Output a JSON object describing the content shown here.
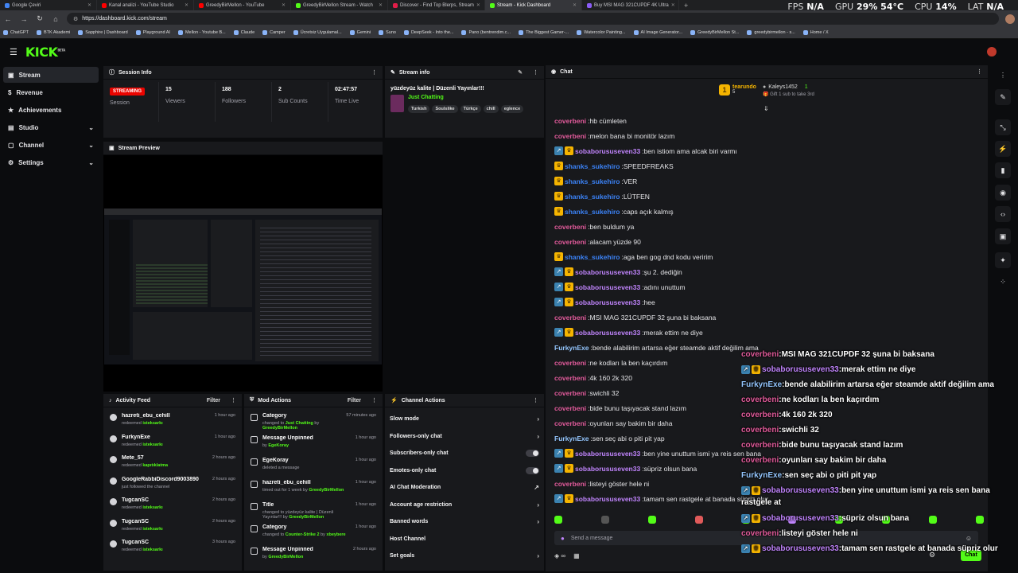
{
  "browser": {
    "tabs": [
      {
        "label": "Google Çeviri",
        "color": "#4285f4"
      },
      {
        "label": "Kanal analizi - YouTube Studio",
        "color": "#ff0000"
      },
      {
        "label": "GreedyBirMellon - YouTube",
        "color": "#ff0000"
      },
      {
        "label": "GreedyBirMellon Stream - Watch",
        "color": "#53fc18"
      },
      {
        "label": "Discover - Find Top Blerps, Stream",
        "color": "#e11d48"
      },
      {
        "label": "Stream - Kick Dashboard",
        "color": "#53fc18"
      },
      {
        "label": "Buy MSI MAG 321CUPDF 4K Ultra",
        "color": "#8b5cf6"
      }
    ],
    "new_tab": "+",
    "url": "https://dashboard.kick.com/stream",
    "bookmarks": [
      "ChatGPT",
      "BTK Akademi",
      "Sapphire | Dashboard",
      "Playground AI",
      "Mellon - Youtube B...",
      "Claude",
      "Camper",
      "Ücretsiz Uygulamal...",
      "Gemini",
      "Suno",
      "DeepSeek - Into the...",
      "Pano (bentrendim.c...",
      "The Biggest Gamer-...",
      "Watercolor Painting...",
      "AI Image Generator...",
      "GreedyBirMellon St...",
      "greedybirmellon - s...",
      "Home / X"
    ]
  },
  "perf": {
    "fps_label": "FPS",
    "fps": "N/A",
    "gpu_label": "GPU",
    "gpu": "29% 54°C",
    "cpu_label": "CPU",
    "cpu": "14%",
    "lat_label": "LAT",
    "lat": "N/A"
  },
  "app": {
    "logo": "KICK",
    "logo_sup": "BETA"
  },
  "sidebar": {
    "items": [
      {
        "label": "Stream"
      },
      {
        "label": "Revenue"
      },
      {
        "label": "Achievements"
      },
      {
        "label": "Studio"
      },
      {
        "label": "Channel"
      },
      {
        "label": "Settings"
      }
    ]
  },
  "session": {
    "title": "Session Info",
    "status": "STREAMING",
    "status_label": "Session",
    "viewers": "15",
    "viewers_label": "Viewers",
    "followers": "188",
    "followers_label": "Followers",
    "subs": "2",
    "subs_label": "Sub Counts",
    "time": "02:47:57",
    "time_label": "Time Live"
  },
  "stream_info": {
    "title": "Stream info",
    "stream_title": "yüzdeyüz kalite | Düzenli Yayınlar!!!",
    "category": "Just Chatting",
    "tags": [
      "Turkish",
      "Soulslike",
      "Türkçe",
      "chill",
      "eglence"
    ]
  },
  "preview": {
    "title": "Stream Preview"
  },
  "activity": {
    "title": "Activity Feed",
    "filter": "Filter",
    "items": [
      {
        "name": "hazreti_ebu_cehill",
        "pre": "redeemed",
        "hl": "isteksarkı",
        "time": "1 hour ago"
      },
      {
        "name": "FurkynExe",
        "pre": "redeemed",
        "hl": "isteksarkı",
        "time": "1 hour ago"
      },
      {
        "name": "Mete_57",
        "pre": "redeemed",
        "hl": "kapıtıklatma",
        "time": "2 hours ago"
      },
      {
        "name": "GoogleRabbiDiscord9003890",
        "pre": "just followed the channel",
        "hl": "",
        "time": "2 hours ago"
      },
      {
        "name": "TugcanSC",
        "pre": "redeemed",
        "hl": "isteksarkı",
        "time": "2 hours ago"
      },
      {
        "name": "TugcanSC",
        "pre": "redeemed",
        "hl": "isteksarkı",
        "time": "2 hours ago"
      },
      {
        "name": "TugcanSC",
        "pre": "redeemed",
        "hl": "isteksarkı",
        "time": "3 hours ago"
      }
    ]
  },
  "mod": {
    "title": "Mod Actions",
    "filter": "Filter",
    "items": [
      {
        "name": "Category",
        "pre": "changed to",
        "hl": "Just Chatting",
        "mid": "by",
        "hl2": "GreedyBirMellon",
        "time": "57 minutes ago"
      },
      {
        "name": "Message Unpinned",
        "pre": "by",
        "hl": "EgeKoray",
        "mid": "",
        "hl2": "",
        "time": "1 hour ago"
      },
      {
        "name": "EgeKoray",
        "pre": "deleted a message",
        "hl": "",
        "mid": "",
        "hl2": "",
        "time": "1 hour ago"
      },
      {
        "name": "hazreti_ebu_cehill",
        "pre": "timed out for 1 week by",
        "hl": "GreedyBirMellon",
        "mid": "",
        "hl2": "",
        "time": "1 hour ago"
      },
      {
        "name": "Title",
        "pre": "changed to yüzdeyüz kalite | Düzenli Yayınlar!!! by",
        "hl": "GreedyBirMellon",
        "mid": "",
        "hl2": "",
        "time": "1 hour ago"
      },
      {
        "name": "Category",
        "pre": "changed to",
        "hl": "Counter-Strike 2",
        "mid": "by",
        "hl2": "xbeybere",
        "time": "1 hour ago"
      },
      {
        "name": "Message Unpinned",
        "pre": "by",
        "hl": "GreedyBirMellon",
        "mid": "",
        "hl2": "",
        "time": "2 hours ago"
      }
    ]
  },
  "channel_actions": {
    "title": "Channel Actions",
    "items": [
      "Slow mode",
      "Followers-only chat",
      "Subscribers-only chat",
      "Emotes-only chat",
      "AI Chat Moderation",
      "Account age restriction",
      "Banned words",
      "Host Channel",
      "Set goals"
    ]
  },
  "chat": {
    "title": "Chat",
    "gift_top": "tearundo",
    "gift_top_count": "5",
    "gift_second": "Kaleys1452",
    "gift_second_count": "1",
    "gift_cta": "Gift 1 sub to take 3rd",
    "messages": [
      {
        "user": "coverbeni",
        "color": "#e05a9a",
        "text": "hb cümleten",
        "badges": []
      },
      {
        "user": "coverbeni",
        "color": "#e05a9a",
        "text": "melon bana bi monitör lazım",
        "badges": []
      },
      {
        "user": "sobaborususeven33",
        "color": "#c084fc",
        "text": "ben istiom ama alcak biri varmı",
        "badges": [
          "b1",
          "b2"
        ]
      },
      {
        "user": "shanks_sukehiro",
        "color": "#3b82f6",
        "text": "SPEEDFREAKS",
        "badges": [
          "b2"
        ]
      },
      {
        "user": "shanks_sukehiro",
        "color": "#3b82f6",
        "text": "VER",
        "badges": [
          "b2"
        ]
      },
      {
        "user": "shanks_sukehiro",
        "color": "#3b82f6",
        "text": "LÜTFEN",
        "badges": [
          "b2"
        ]
      },
      {
        "user": "shanks_sukehiro",
        "color": "#3b82f6",
        "text": "caps açık kalmış",
        "badges": [
          "b2"
        ]
      },
      {
        "user": "coverbeni",
        "color": "#e05a9a",
        "text": "ben buldum ya",
        "badges": []
      },
      {
        "user": "coverbeni",
        "color": "#e05a9a",
        "text": "alacam yüzde 90",
        "badges": []
      },
      {
        "user": "shanks_sukehiro",
        "color": "#3b82f6",
        "text": "aga ben gog dnd kodu veririm",
        "badges": [
          "b2"
        ]
      },
      {
        "user": "sobaborususeven33",
        "color": "#c084fc",
        "text": "şu 2. dediğin",
        "badges": [
          "b1",
          "b2"
        ]
      },
      {
        "user": "sobaborususeven33",
        "color": "#c084fc",
        "text": "adını unuttum",
        "badges": [
          "b1",
          "b2"
        ]
      },
      {
        "user": "sobaborususeven33",
        "color": "#c084fc",
        "text": "hee",
        "badges": [
          "b1",
          "b2"
        ]
      },
      {
        "user": "coverbeni",
        "color": "#e05a9a",
        "text": "MSI MAG 321CUPDF 32 şuna bi baksana",
        "badges": []
      },
      {
        "user": "sobaborususeven33",
        "color": "#c084fc",
        "text": "merak ettim ne diye",
        "badges": [
          "b1",
          "b2"
        ]
      },
      {
        "user": "FurkynExe",
        "color": "#93c5fd",
        "text": "bende alabilirim artarsa eğer steamde aktif değilim ama",
        "badges": []
      },
      {
        "user": "coverbeni",
        "color": "#e05a9a",
        "text": "ne kodları la ben kaçırdım",
        "badges": []
      },
      {
        "user": "coverbeni",
        "color": "#e05a9a",
        "text": "4k 160 2k 320",
        "badges": []
      },
      {
        "user": "coverbeni",
        "color": "#e05a9a",
        "text": "swichli 32",
        "badges": []
      },
      {
        "user": "coverbeni",
        "color": "#e05a9a",
        "text": "bide bunu taşıyacak stand lazım",
        "badges": []
      },
      {
        "user": "coverbeni",
        "color": "#e05a9a",
        "text": "oyunları say bakim bir daha",
        "badges": []
      },
      {
        "user": "FurkynExe",
        "color": "#93c5fd",
        "text": "sen seç abi o piti pit yap",
        "badges": []
      },
      {
        "user": "sobaborususeven33",
        "color": "#c084fc",
        "text": "ben yine unuttum ismi ya reis sen bana",
        "badges": [
          "b1",
          "b2"
        ]
      },
      {
        "user": "sobaborususeven33",
        "color": "#c084fc",
        "text": "süpriz olsun bana",
        "badges": [
          "b1",
          "b2"
        ]
      },
      {
        "user": "coverbeni",
        "color": "#e05a9a",
        "text": "listeyi göster hele ni",
        "badges": []
      },
      {
        "user": "sobaborususeven33",
        "color": "#c084fc",
        "text": "tamam sen rastgele at banada süpriz olur",
        "badges": [
          "b1",
          "b2"
        ]
      }
    ],
    "placeholder": "Send a message",
    "send_label": "Chat"
  },
  "overlay": {
    "messages": [
      {
        "user": "coverbeni",
        "color": "#e05a9a",
        "text": "MSI MAG 321CUPDF 32 şuna bi baksana",
        "badges": []
      },
      {
        "user": "sobaborususeven33",
        "color": "#c084fc",
        "text": "merak ettim ne diye",
        "badges": [
          "b1",
          "b2"
        ]
      },
      {
        "user": "FurkynExe",
        "color": "#93c5fd",
        "text": "bende alabilirim artarsa eğer steamde aktif değilim ama",
        "badges": []
      },
      {
        "user": "coverbeni",
        "color": "#e05a9a",
        "text": "ne kodları la ben kaçırdım",
        "badges": []
      },
      {
        "user": "coverbeni",
        "color": "#e05a9a",
        "text": "4k 160 2k 320",
        "badges": []
      },
      {
        "user": "coverbeni",
        "color": "#e05a9a",
        "text": "swichli 32",
        "badges": []
      },
      {
        "user": "coverbeni",
        "color": "#e05a9a",
        "text": "bide bunu taşıyacak stand lazım",
        "badges": []
      },
      {
        "user": "coverbeni",
        "color": "#e05a9a",
        "text": "oyunları say bakim bir daha",
        "badges": []
      },
      {
        "user": "FurkynExe",
        "color": "#93c5fd",
        "text": "sen seç abi o piti pit yap",
        "badges": []
      },
      {
        "user": "sobaborususeven33",
        "color": "#c084fc",
        "text": "ben yine unuttum ismi ya reis sen bana",
        "badges": [
          "b1",
          "b2"
        ]
      },
      {
        "user": "",
        "color": "#fff",
        "text": "",
        "extra": "rastgele at",
        "badges": []
      },
      {
        "user": "sobaborususeven33",
        "color": "#c084fc",
        "text": "süpriz olsun bana",
        "badges": [
          "b1",
          "b2"
        ]
      },
      {
        "user": "coverbeni",
        "color": "#e05a9a",
        "text": "listeyi göster hele ni",
        "badges": []
      },
      {
        "user": "sobaborususeven33",
        "color": "#c084fc",
        "text": "tamam sen rastgele at banada süpriz olur",
        "badges": [
          "b1",
          "b2"
        ]
      }
    ]
  },
  "colors": {
    "accent": "#53fc18",
    "live": "#eb0400",
    "panel": "#18191c",
    "bg": "#0b0c0e"
  },
  "icons": [
    "back-icon",
    "forward-icon",
    "reload-icon",
    "home-icon",
    "menu-icon",
    "chevron-down-icon",
    "more-icon",
    "edit-icon",
    "chat-icon",
    "pencil-icon",
    "gift-icon",
    "emote-icon",
    "settings-icon",
    "send-icon"
  ]
}
